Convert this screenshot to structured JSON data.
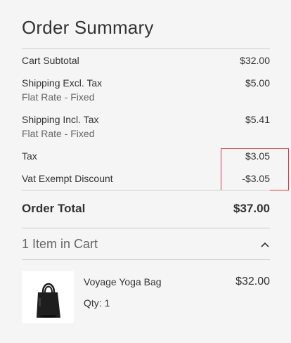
{
  "summary": {
    "title": "Order Summary",
    "rows": [
      {
        "label": "Cart Subtotal",
        "sub": "",
        "amount": "$32.00"
      },
      {
        "label": "Shipping Excl. Tax",
        "sub": "Flat Rate - Fixed",
        "amount": "$5.00"
      },
      {
        "label": "Shipping Incl. Tax",
        "sub": "Flat Rate - Fixed",
        "amount": "$5.41"
      },
      {
        "label": "Tax",
        "sub": "",
        "amount": "$3.05"
      },
      {
        "label": "Vat Exempt Discount",
        "sub": "",
        "amount": "-$3.05"
      }
    ],
    "total_label": "Order Total",
    "total_amount": "$37.00"
  },
  "cart": {
    "items_label": "1 Item in Cart",
    "toggle_icon": "chevron-up-icon",
    "items": [
      {
        "name": "Voyage Yoga Bag",
        "qty_label": "Qty:",
        "qty": "1",
        "price": "$32.00",
        "image_icon": "tote-bag-thumbnail"
      }
    ]
  },
  "colors": {
    "background": "#f5f5f5",
    "text": "#333333",
    "divider": "#cccccc",
    "highlight": "#d9363e"
  }
}
